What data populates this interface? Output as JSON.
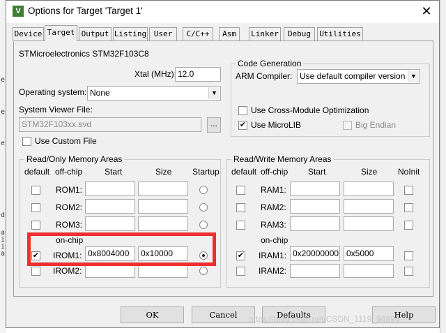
{
  "window": {
    "title": "Options for Target 'Target 1'",
    "icon": "keil-v-icon",
    "close_glyph": "✕"
  },
  "tabs": [
    {
      "label": "Device"
    },
    {
      "label": "Target",
      "active": true
    },
    {
      "label": "Output"
    },
    {
      "label": "Listing"
    },
    {
      "label": "User"
    },
    {
      "label": "C/C++"
    },
    {
      "label": "Asm"
    },
    {
      "label": "Linker"
    },
    {
      "label": "Debug"
    },
    {
      "label": "Utilities"
    }
  ],
  "target": {
    "device_name": "STMicroelectronics STM32F103C8",
    "xtal_label": "Xtal (MHz):",
    "xtal_value": "12.0",
    "os_label": "Operating system:",
    "os_value": "None",
    "sysviewer_label": "System Viewer File:",
    "sysviewer_value": "STM32F103xx.svd",
    "browse_label": "...",
    "use_custom_file_label": "Use Custom File",
    "use_custom_file_checked": false
  },
  "code_generation": {
    "group_label": "Code Generation",
    "arm_compiler_label": "ARM Compiler:",
    "arm_compiler_value": "Use default compiler version",
    "cross_module_label": "Use Cross-Module Optimization",
    "cross_module_checked": false,
    "microlib_label": "Use MicroLIB",
    "microlib_checked": true,
    "big_endian_label": "Big Endian",
    "big_endian_checked": false
  },
  "ro_memory": {
    "group_label": "Read/Only Memory Areas",
    "headers": {
      "default": "default",
      "offchip": "off-chip",
      "start": "Start",
      "size": "Size",
      "startup": "Startup"
    },
    "onchip_label": "on-chip",
    "rows": [
      {
        "name": "ROM1:",
        "default": false,
        "start": "",
        "size": "",
        "startup": false
      },
      {
        "name": "ROM2:",
        "default": false,
        "start": "",
        "size": "",
        "startup": false
      },
      {
        "name": "ROM3:",
        "default": false,
        "start": "",
        "size": "",
        "startup": false
      },
      {
        "name": "IROM1:",
        "default": true,
        "start": "0x8004000",
        "size": "0x10000",
        "startup": true
      },
      {
        "name": "IROM2:",
        "default": false,
        "start": "",
        "size": "",
        "startup": false
      }
    ]
  },
  "rw_memory": {
    "group_label": "Read/Write Memory Areas",
    "headers": {
      "default": "default",
      "offchip": "off-chip",
      "start": "Start",
      "size": "Size",
      "noinit": "NoInit"
    },
    "onchip_label": "on-chip",
    "rows": [
      {
        "name": "RAM1:",
        "default": false,
        "start": "",
        "size": "",
        "noinit": false
      },
      {
        "name": "RAM2:",
        "default": false,
        "start": "",
        "size": "",
        "noinit": false
      },
      {
        "name": "RAM3:",
        "default": false,
        "start": "",
        "size": "",
        "noinit": false
      },
      {
        "name": "IRAM1:",
        "default": true,
        "start": "0x20000000",
        "size": "0x5000",
        "noinit": false
      },
      {
        "name": "IRAM2:",
        "default": false,
        "start": "",
        "size": "",
        "noinit": false
      }
    ]
  },
  "buttons": {
    "ok": "OK",
    "cancel": "Cancel",
    "defaults": "Defaults",
    "help": "Help"
  },
  "watermark": "https://blog.csdn.net/CSDN_1119_94894",
  "background_editor_fragments": [
    "e",
    "e",
    "e",
    "d",
    "a",
    "i",
    "i",
    "a"
  ],
  "colors": {
    "highlight": "#ec2f2f",
    "title_icon": "#3f7d33"
  }
}
